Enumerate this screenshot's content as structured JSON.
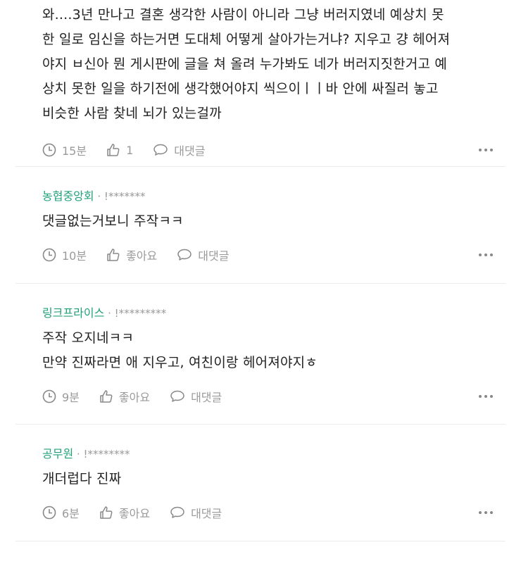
{
  "comments": [
    {
      "author": "",
      "masked_id": "",
      "text": "와....3년 만나고 결혼 생각한 사람이 아니라 그냥 버러지였네 예상치 못\n한 일로 임신을 하는거면 도대체 어떻게 살아가는거냐? 지우고 걍 헤어져\n야지 ㅂ신아 뭔 게시판에 글을 쳐 올려 누가봐도 네가 버러지짓한거고 예\n상치 못한 일을 하기전에 생각했어야지 씩으이ㅣㅣ바 안에 싸질러 놓고\n비슷한 사람 찾네 뇌가 있는걸까",
      "time": "15분",
      "like": "1",
      "reply": "대댓글"
    },
    {
      "author": "농협중앙회",
      "masked_id": "· !*******",
      "text": "댓글없는거보니 주작ㅋㅋ",
      "time": "10분",
      "like": "좋아요",
      "reply": "대댓글"
    },
    {
      "author": "링크프라이스",
      "masked_id": "· !*********",
      "text": "주작 오지네ㅋㅋ\n만약 진짜라면 애 지우고, 여친이랑 헤어져야지ㅎ",
      "time": "9분",
      "like": "좋아요",
      "reply": "대댓글"
    },
    {
      "author": "공무원",
      "masked_id": "· !********",
      "text": "개더럽다 진짜",
      "time": "6분",
      "like": "좋아요",
      "reply": "대댓글"
    }
  ]
}
